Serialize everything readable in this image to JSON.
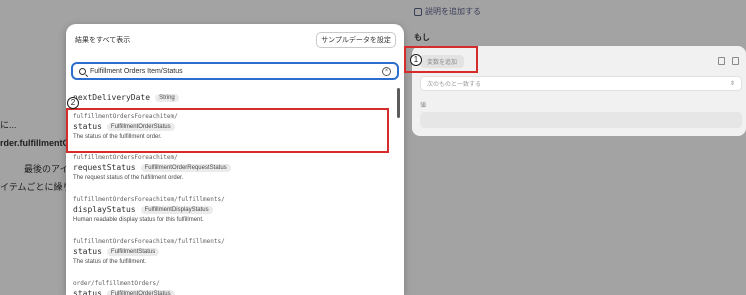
{
  "background": {
    "node_1": "に...",
    "node_2": "rder.fulfillmentOr",
    "node_3": "最後のアイ",
    "node_4": "イテムごとに繰り"
  },
  "right_panel": {
    "add_description": "説明を追加する",
    "if_label": "もし",
    "variable_button": "変数を追加",
    "select_placeholder": "次のものと一致する",
    "value_label": "値"
  },
  "popup": {
    "title": "結果をすべて表示",
    "sample_button": "サンプルデータを設定",
    "search_value": "Fulfillment Orders Item/Status",
    "items": [
      {
        "path": "",
        "name": "nextDeliveryDate",
        "type": "String",
        "desc": ""
      },
      {
        "path": "fulfillmentOrdersForeachitem/",
        "name": "status",
        "type": "FulfillmentOrderStatus",
        "desc": "The status of the fulfillment order."
      },
      {
        "path": "fulfillmentOrdersForeachitem/",
        "name": "requestStatus",
        "type": "FulfillmentOrderRequestStatus",
        "desc": "The request status of the fulfillment order."
      },
      {
        "path": "fulfillmentOrdersForeachitem/fulfillments/",
        "name": "displayStatus",
        "type": "FulfillmentDisplayStatus",
        "desc": "Human readable display status for this fulfillment."
      },
      {
        "path": "fulfillmentOrdersForeachitem/fulfillments/",
        "name": "status",
        "type": "FulfillmentStatus",
        "desc": "The status of the fulfillment."
      },
      {
        "path": "order/fulfillmentOrders/",
        "name": "status",
        "type": "FulfillmentOrderStatus",
        "desc": ""
      }
    ]
  },
  "markers": {
    "one": "1",
    "two": "2"
  },
  "colors": {
    "highlight": "#d52b2b",
    "focus": "#2c6ecb"
  }
}
